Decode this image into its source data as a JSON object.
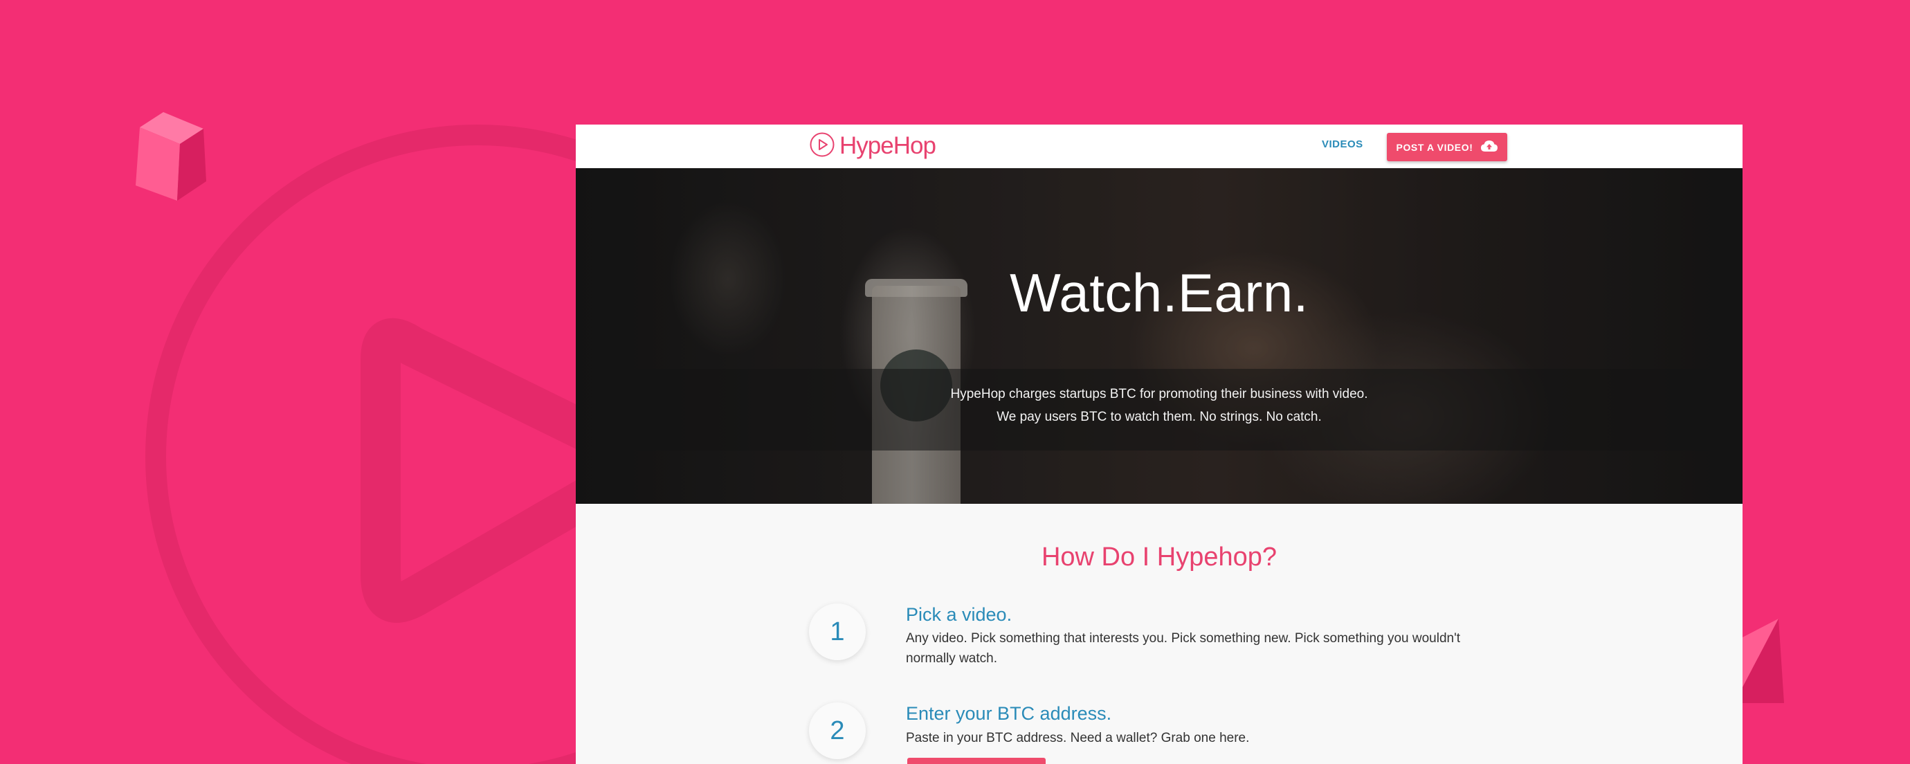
{
  "colors": {
    "background": "#f32e74",
    "brand_pink": "#e8426f",
    "accent_blue": "#2a8bb8",
    "button_pink": "#ef4b6c"
  },
  "navbar": {
    "logo_text": "HypeHop",
    "logo_icon": "play-circle-icon",
    "videos_link": "VIDEOS",
    "post_button_label": "POST A VIDEO!",
    "post_button_icon": "cloud-upload-icon"
  },
  "hero": {
    "title": "Watch.Earn.",
    "line1": "HypeHop charges startups BTC for promoting their business with video.",
    "line2": "We pay users BTC to watch them. No strings. No catch."
  },
  "how": {
    "title": "How Do I Hypehop?",
    "steps": [
      {
        "number": "1",
        "title": "Pick a video.",
        "desc": "Any video. Pick something that interests you. Pick something new. Pick something you wouldn't normally watch."
      },
      {
        "number": "2",
        "title": "Enter your BTC address.",
        "desc": "Paste in your BTC address. Need a wallet? Grab one here."
      }
    ]
  }
}
